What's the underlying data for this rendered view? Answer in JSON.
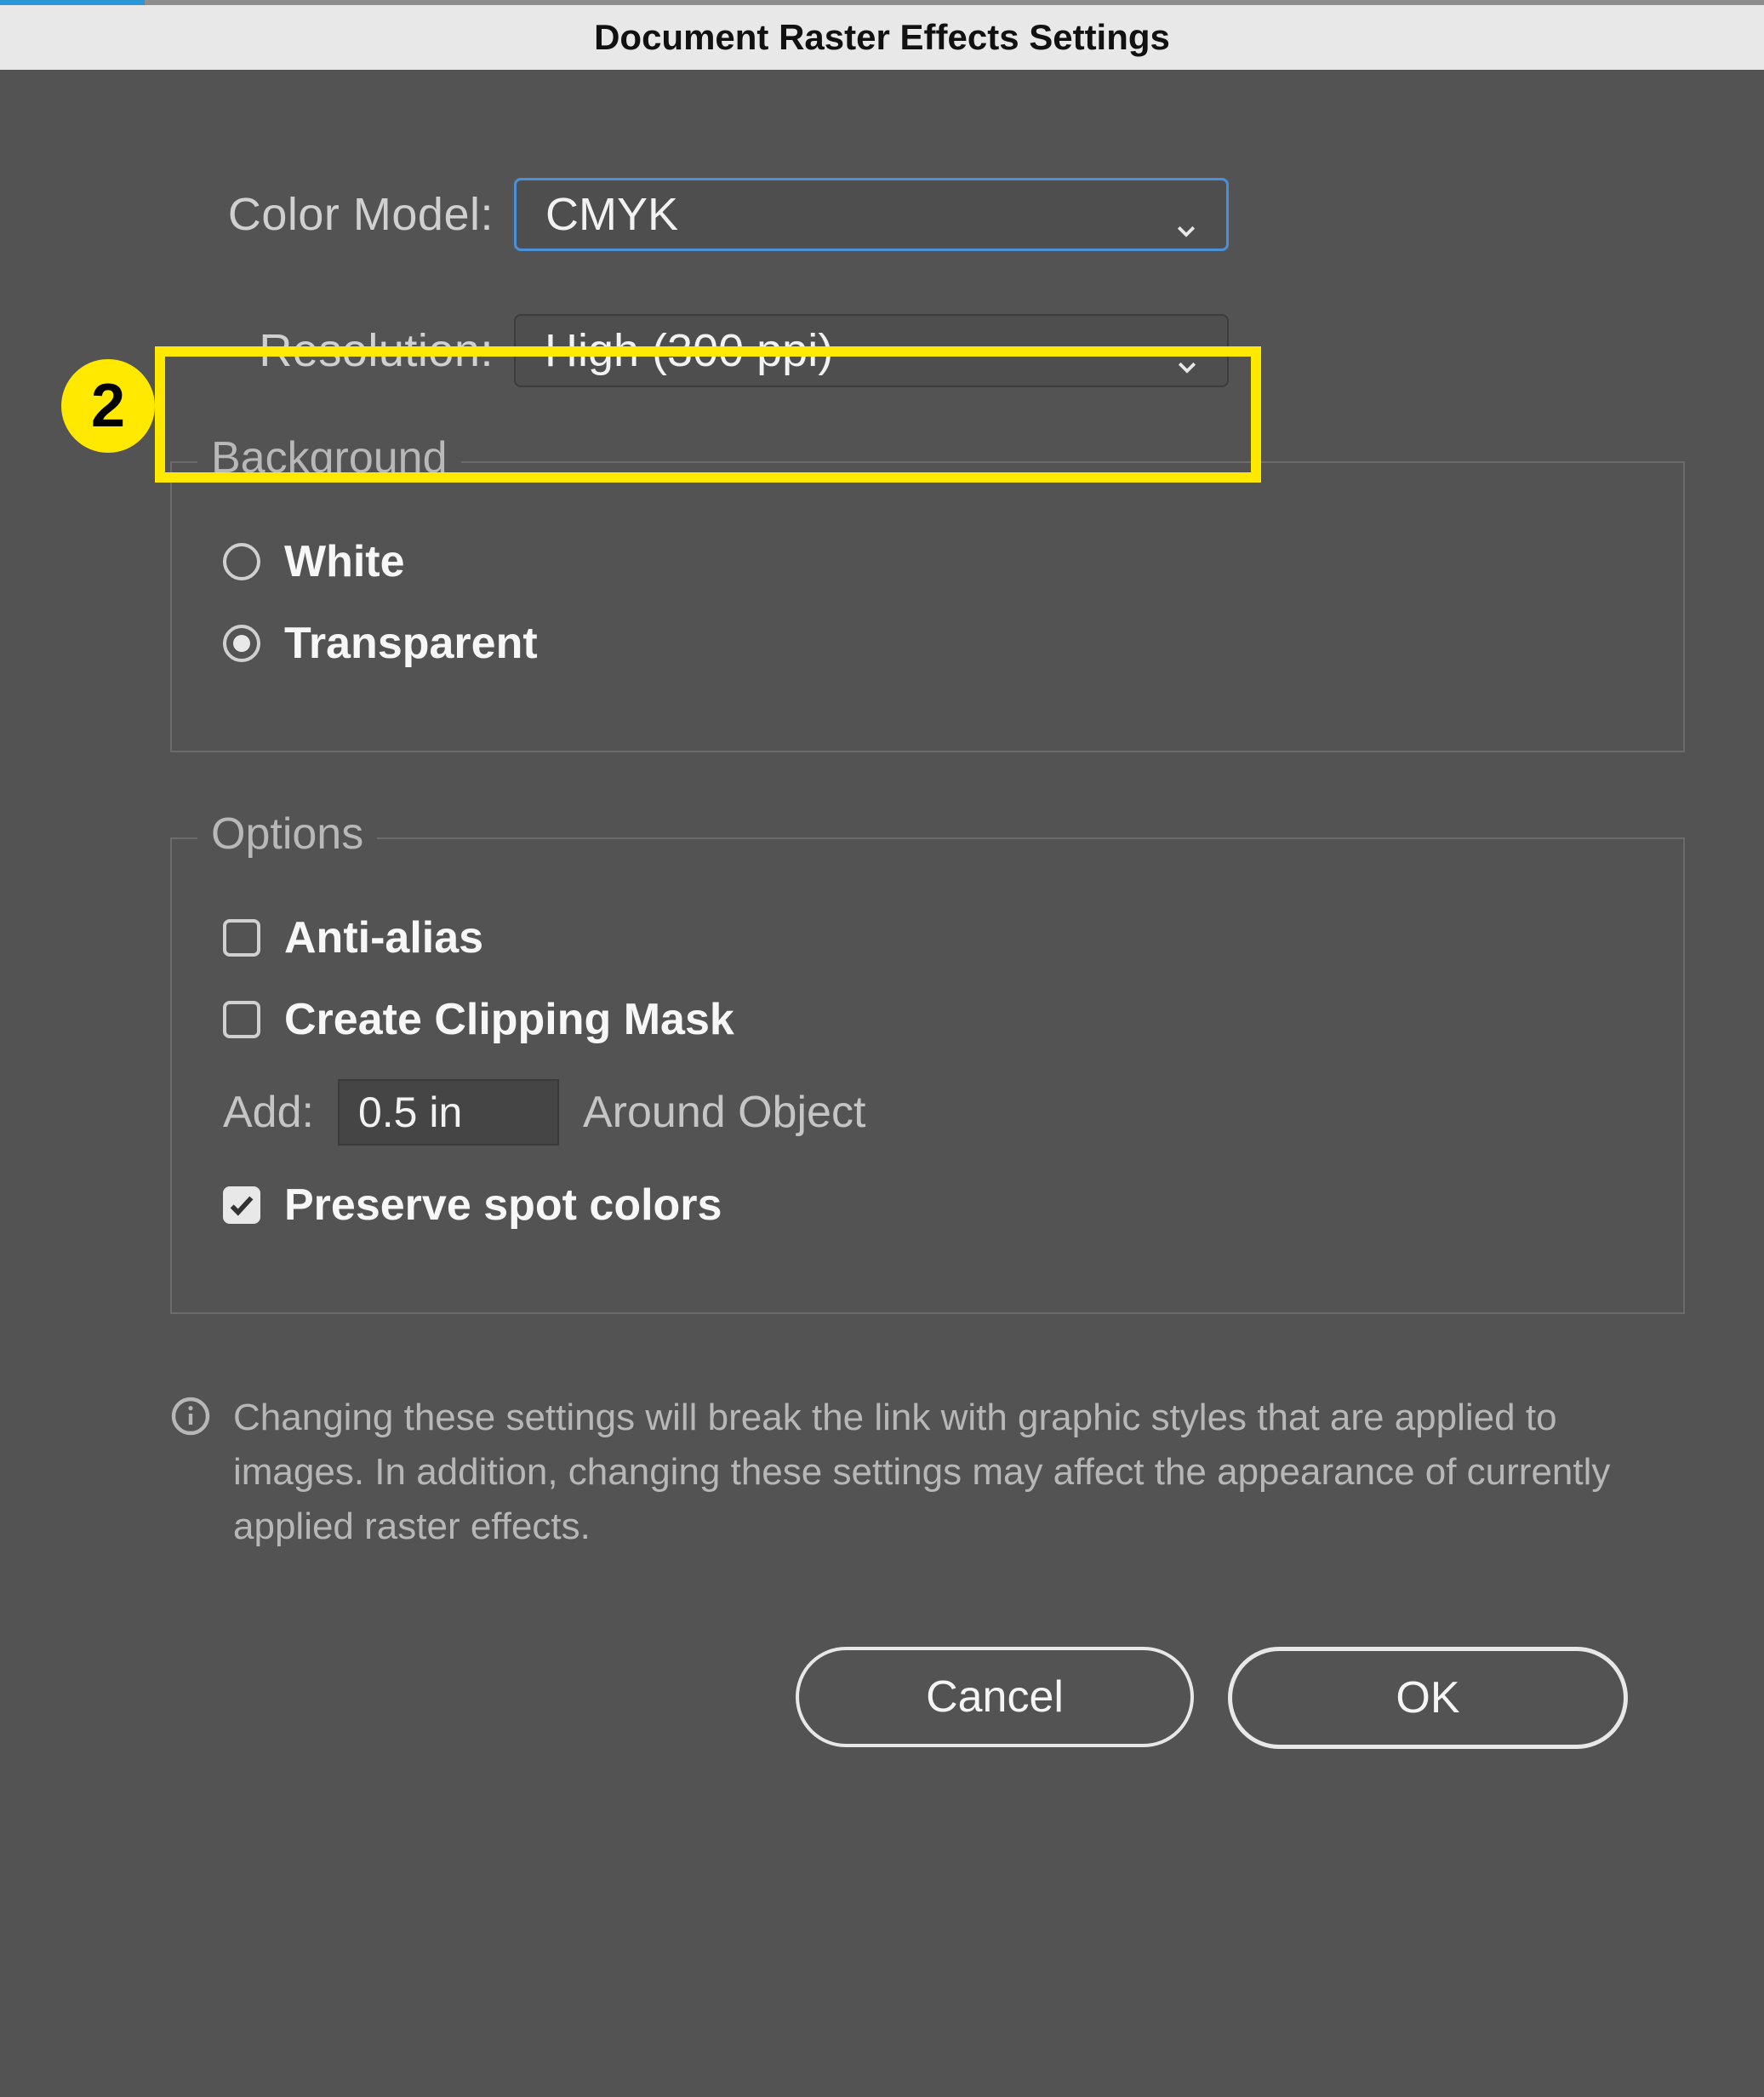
{
  "dialog": {
    "title": "Document Raster Effects Settings",
    "colorModel": {
      "label": "Color Model:",
      "value": "CMYK"
    },
    "resolution": {
      "label": "Resolution:",
      "value": "High (300 ppi)"
    },
    "background": {
      "legend": "Background",
      "options": {
        "white": "White",
        "transparent": "Transparent"
      },
      "selected": "transparent"
    },
    "options": {
      "legend": "Options",
      "antiAlias": {
        "label": "Anti-alias",
        "checked": false
      },
      "clippingMask": {
        "label": "Create Clipping Mask",
        "checked": false
      },
      "add": {
        "prefix": "Add:",
        "value": "0.5 in",
        "suffix": "Around Object"
      },
      "preserveSpot": {
        "label": "Preserve spot colors",
        "checked": true
      }
    },
    "note": "Changing these settings will break the link with graphic styles that are applied to images. In addition, changing these settings may affect the appearance of currently applied raster effects.",
    "buttons": {
      "cancel": "Cancel",
      "ok": "OK"
    }
  },
  "annotation": {
    "number": "2"
  }
}
